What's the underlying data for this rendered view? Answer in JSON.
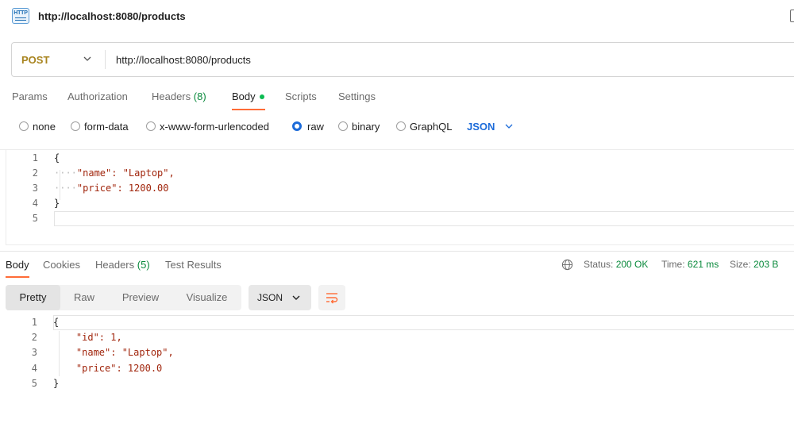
{
  "window": {
    "title": "http://localhost:8080/products",
    "icon": "http-icon",
    "icon_text": "HTTP"
  },
  "request": {
    "method": "POST",
    "url": "http://localhost:8080/products",
    "tabs": [
      {
        "label": "Params"
      },
      {
        "label": "Authorization"
      },
      {
        "label": "Headers",
        "count": "(8)"
      },
      {
        "label": "Body",
        "active": true
      },
      {
        "label": "Scripts"
      },
      {
        "label": "Settings"
      }
    ],
    "body_types": [
      {
        "label": "none",
        "checked": false
      },
      {
        "label": "form-data",
        "checked": false
      },
      {
        "label": "x-www-form-urlencoded",
        "checked": false
      },
      {
        "label": "raw",
        "checked": true
      },
      {
        "label": "binary",
        "checked": false
      },
      {
        "label": "GraphQL",
        "checked": false
      }
    ],
    "language": "JSON",
    "body_lines": [
      "{",
      "\"name\": \"Laptop\",",
      "\"price\": 1200.00",
      "}",
      ""
    ],
    "line_numbers": [
      "1",
      "2",
      "3",
      "4",
      "5"
    ]
  },
  "response": {
    "tabs": [
      {
        "label": "Body",
        "active": true
      },
      {
        "label": "Cookies"
      },
      {
        "label": "Headers",
        "count": "(5)"
      },
      {
        "label": "Test Results"
      }
    ],
    "status_label": "Status:",
    "status_value": "200 OK",
    "time_label": "Time:",
    "time_value": "621 ms",
    "size_label": "Size:",
    "size_value": "203 B",
    "views": [
      "Pretty",
      "Raw",
      "Preview",
      "Visualize"
    ],
    "active_view": "Pretty",
    "format": "JSON",
    "body_lines": [
      "{",
      "\"id\": 1,",
      "\"name\": \"Laptop\",",
      "\"price\": 1200.0",
      "}"
    ],
    "line_numbers": [
      "1",
      "2",
      "3",
      "4",
      "5"
    ]
  },
  "colors": {
    "accent": "#ff6c37",
    "method_post": "#a8841f",
    "link_blue": "#1c6bd9",
    "status_green": "#0a8a3c"
  }
}
